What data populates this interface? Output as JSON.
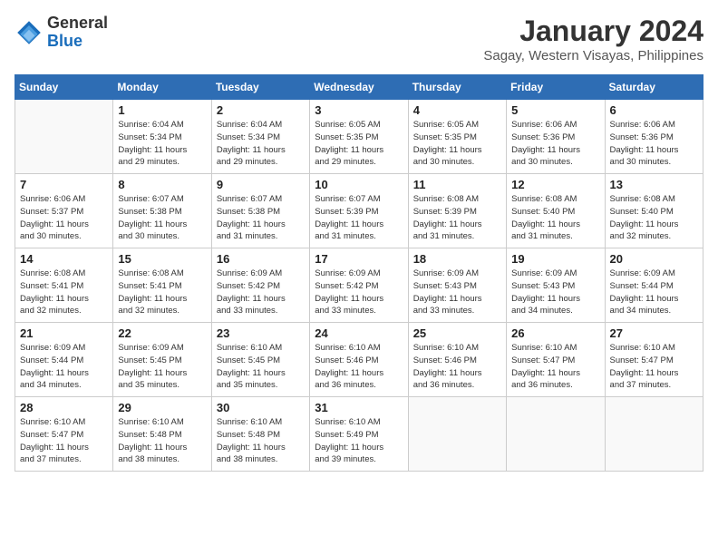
{
  "header": {
    "logo_general": "General",
    "logo_blue": "Blue",
    "month_title": "January 2024",
    "subtitle": "Sagay, Western Visayas, Philippines"
  },
  "days_of_week": [
    "Sunday",
    "Monday",
    "Tuesday",
    "Wednesday",
    "Thursday",
    "Friday",
    "Saturday"
  ],
  "weeks": [
    [
      {
        "num": "",
        "info": ""
      },
      {
        "num": "1",
        "info": "Sunrise: 6:04 AM\nSunset: 5:34 PM\nDaylight: 11 hours\nand 29 minutes."
      },
      {
        "num": "2",
        "info": "Sunrise: 6:04 AM\nSunset: 5:34 PM\nDaylight: 11 hours\nand 29 minutes."
      },
      {
        "num": "3",
        "info": "Sunrise: 6:05 AM\nSunset: 5:35 PM\nDaylight: 11 hours\nand 29 minutes."
      },
      {
        "num": "4",
        "info": "Sunrise: 6:05 AM\nSunset: 5:35 PM\nDaylight: 11 hours\nand 30 minutes."
      },
      {
        "num": "5",
        "info": "Sunrise: 6:06 AM\nSunset: 5:36 PM\nDaylight: 11 hours\nand 30 minutes."
      },
      {
        "num": "6",
        "info": "Sunrise: 6:06 AM\nSunset: 5:36 PM\nDaylight: 11 hours\nand 30 minutes."
      }
    ],
    [
      {
        "num": "7",
        "info": "Sunrise: 6:06 AM\nSunset: 5:37 PM\nDaylight: 11 hours\nand 30 minutes."
      },
      {
        "num": "8",
        "info": "Sunrise: 6:07 AM\nSunset: 5:38 PM\nDaylight: 11 hours\nand 30 minutes."
      },
      {
        "num": "9",
        "info": "Sunrise: 6:07 AM\nSunset: 5:38 PM\nDaylight: 11 hours\nand 31 minutes."
      },
      {
        "num": "10",
        "info": "Sunrise: 6:07 AM\nSunset: 5:39 PM\nDaylight: 11 hours\nand 31 minutes."
      },
      {
        "num": "11",
        "info": "Sunrise: 6:08 AM\nSunset: 5:39 PM\nDaylight: 11 hours\nand 31 minutes."
      },
      {
        "num": "12",
        "info": "Sunrise: 6:08 AM\nSunset: 5:40 PM\nDaylight: 11 hours\nand 31 minutes."
      },
      {
        "num": "13",
        "info": "Sunrise: 6:08 AM\nSunset: 5:40 PM\nDaylight: 11 hours\nand 32 minutes."
      }
    ],
    [
      {
        "num": "14",
        "info": "Sunrise: 6:08 AM\nSunset: 5:41 PM\nDaylight: 11 hours\nand 32 minutes."
      },
      {
        "num": "15",
        "info": "Sunrise: 6:08 AM\nSunset: 5:41 PM\nDaylight: 11 hours\nand 32 minutes."
      },
      {
        "num": "16",
        "info": "Sunrise: 6:09 AM\nSunset: 5:42 PM\nDaylight: 11 hours\nand 33 minutes."
      },
      {
        "num": "17",
        "info": "Sunrise: 6:09 AM\nSunset: 5:42 PM\nDaylight: 11 hours\nand 33 minutes."
      },
      {
        "num": "18",
        "info": "Sunrise: 6:09 AM\nSunset: 5:43 PM\nDaylight: 11 hours\nand 33 minutes."
      },
      {
        "num": "19",
        "info": "Sunrise: 6:09 AM\nSunset: 5:43 PM\nDaylight: 11 hours\nand 34 minutes."
      },
      {
        "num": "20",
        "info": "Sunrise: 6:09 AM\nSunset: 5:44 PM\nDaylight: 11 hours\nand 34 minutes."
      }
    ],
    [
      {
        "num": "21",
        "info": "Sunrise: 6:09 AM\nSunset: 5:44 PM\nDaylight: 11 hours\nand 34 minutes."
      },
      {
        "num": "22",
        "info": "Sunrise: 6:09 AM\nSunset: 5:45 PM\nDaylight: 11 hours\nand 35 minutes."
      },
      {
        "num": "23",
        "info": "Sunrise: 6:10 AM\nSunset: 5:45 PM\nDaylight: 11 hours\nand 35 minutes."
      },
      {
        "num": "24",
        "info": "Sunrise: 6:10 AM\nSunset: 5:46 PM\nDaylight: 11 hours\nand 36 minutes."
      },
      {
        "num": "25",
        "info": "Sunrise: 6:10 AM\nSunset: 5:46 PM\nDaylight: 11 hours\nand 36 minutes."
      },
      {
        "num": "26",
        "info": "Sunrise: 6:10 AM\nSunset: 5:47 PM\nDaylight: 11 hours\nand 36 minutes."
      },
      {
        "num": "27",
        "info": "Sunrise: 6:10 AM\nSunset: 5:47 PM\nDaylight: 11 hours\nand 37 minutes."
      }
    ],
    [
      {
        "num": "28",
        "info": "Sunrise: 6:10 AM\nSunset: 5:47 PM\nDaylight: 11 hours\nand 37 minutes."
      },
      {
        "num": "29",
        "info": "Sunrise: 6:10 AM\nSunset: 5:48 PM\nDaylight: 11 hours\nand 38 minutes."
      },
      {
        "num": "30",
        "info": "Sunrise: 6:10 AM\nSunset: 5:48 PM\nDaylight: 11 hours\nand 38 minutes."
      },
      {
        "num": "31",
        "info": "Sunrise: 6:10 AM\nSunset: 5:49 PM\nDaylight: 11 hours\nand 39 minutes."
      },
      {
        "num": "",
        "info": ""
      },
      {
        "num": "",
        "info": ""
      },
      {
        "num": "",
        "info": ""
      }
    ]
  ]
}
